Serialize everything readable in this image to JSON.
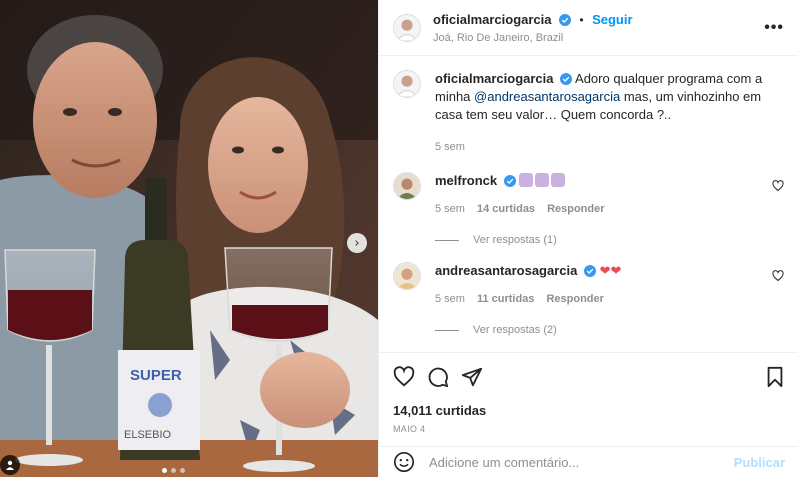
{
  "post": {
    "username": "oficialmarciogarcia",
    "follow_label": "Seguir",
    "location": "Joá, Rio De Janeiro, Brazil",
    "more_label": "•••"
  },
  "caption": {
    "username": "oficialmarciogarcia",
    "text_before": "Adoro qualquer programa com a minha ",
    "mention": "@andreasantarosagarcia",
    "text_after": " mas, um vinhozinho em casa tem seu valor… Quem concorda ?..",
    "time": "5 sem"
  },
  "comments": [
    {
      "username": "melfronck",
      "time": "5 sem",
      "likes": "14 curtidas",
      "reply_label": "Responder",
      "view_replies": "Ver respostas (1)"
    },
    {
      "username": "andreasantarosagarcia",
      "text": "❤❤",
      "time": "5 sem",
      "likes": "11 curtidas",
      "reply_label": "Responder",
      "view_replies": "Ver respostas (2)"
    }
  ],
  "photo": {
    "label_text": "SUPER",
    "brand_text": "ELSEBIO",
    "next_icon": "chevron-right-icon"
  },
  "stats": {
    "likes": "14,011 curtidas",
    "date": "MAIO 4"
  },
  "composer": {
    "placeholder": "Adicione um comentário...",
    "post_label": "Publicar"
  },
  "colors": {
    "accent": "#0095f6",
    "verified": "#3897f0",
    "heart": "#ed4956"
  }
}
